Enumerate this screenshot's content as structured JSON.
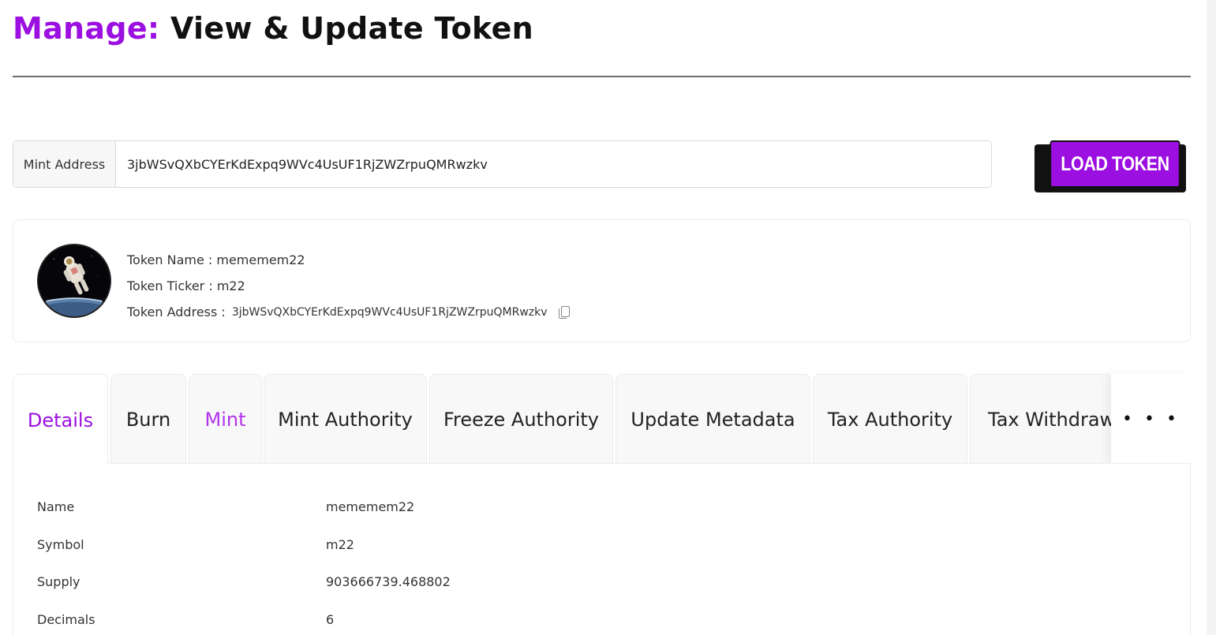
{
  "header": {
    "title_accent": "Manage:",
    "title_rest": "View & Update Token"
  },
  "mint": {
    "label": "Mint Address",
    "value": "3jbWSvQXbCYErKdExpq9WVc4UsUF1RjZWZrpuQMRwzkv"
  },
  "load_button": {
    "label": "LOAD TOKEN"
  },
  "token": {
    "avatar_icon": "astronaut-image",
    "name_row": "Token Name : mememem22",
    "ticker_row": "Token Ticker : m22",
    "address_label": "Token Address :",
    "address_value": "3jbWSvQXbCYErKdExpq9WVc4UsUF1RjZWZrpuQMRwzkv",
    "copy_icon": "copy-icon"
  },
  "tabs": [
    {
      "label": "Details"
    },
    {
      "label": "Burn"
    },
    {
      "label": "Mint"
    },
    {
      "label": "Mint Authority"
    },
    {
      "label": "Freeze Authority"
    },
    {
      "label": "Update Metadata"
    },
    {
      "label": "Tax Authority"
    },
    {
      "label": "Tax Withdraw"
    }
  ],
  "tabs_more": "• • •",
  "details": [
    {
      "key": "Name",
      "value": "mememem22"
    },
    {
      "key": "Symbol",
      "value": "m22"
    },
    {
      "key": "Supply",
      "value": "903666739.468802"
    },
    {
      "key": "Decimals",
      "value": "6"
    }
  ],
  "colors": {
    "accent": "#9b0fe0",
    "tab_mint": "#b033ec",
    "button_shadow": "#111111"
  }
}
